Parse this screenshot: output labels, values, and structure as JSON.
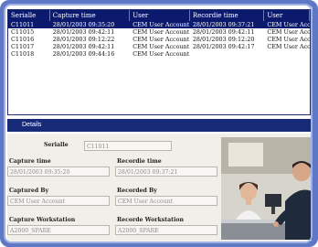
{
  "list": {
    "columns": [
      "Serialle",
      "Capture time",
      "User",
      "Recordie time",
      "User"
    ],
    "rows": [
      [
        "C11011",
        "28/01/2003 09:35:20",
        "CEM User Account",
        "28/01/2003 09:37:21",
        "CEM User Account"
      ],
      [
        "C11015",
        "28/01/2003 09:42:11",
        "CEM User Account",
        "28/01/2003 09:42:11",
        "CEM User Account"
      ],
      [
        "C11016",
        "28/01/2003 09:12:22",
        "CEM User Account",
        "28/01/2003 09:12:20",
        "CEM User Account"
      ],
      [
        "C11017",
        "28/01/2003 09:42:11",
        "CEM User Account",
        "28/01/2003 09:42:17",
        "CEM User Account"
      ],
      [
        "C11018",
        "28/01/2003 09:44:16",
        "CEM User Account",
        "",
        ""
      ]
    ]
  },
  "details": {
    "title": "Details",
    "serial_label": "Serialle",
    "serial_value": "C11011",
    "capture_time_label": "Capture time",
    "capture_time_value": "28/01/2003 09:35:20",
    "recordie_time_label": "Recordie time",
    "recordie_time_value": "28/01/2003 09:37:21",
    "captured_by_label": "Captured By",
    "captured_by_value": "CEM User Account",
    "recorded_by_label": "Recorded By",
    "recorded_by_value": "CEM User Account",
    "capture_ws_label": "Capture Workstation",
    "capture_ws_value": "A2000_SPARE",
    "recorde_ws_label": "Recorde Workstation",
    "recorde_ws_value": "A2000_SPARE"
  }
}
